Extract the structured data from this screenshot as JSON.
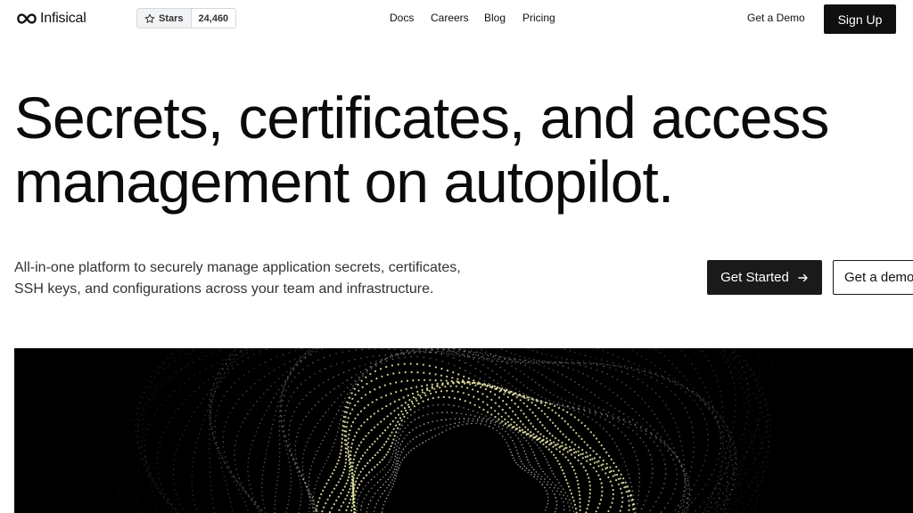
{
  "brand": {
    "name": "Infisical",
    "logo_icon": "infinity-icon"
  },
  "github": {
    "label": "Stars",
    "count": "24,460",
    "icon": "star-icon"
  },
  "nav": {
    "items": [
      {
        "label": "Docs"
      },
      {
        "label": "Careers"
      },
      {
        "label": "Blog"
      },
      {
        "label": "Pricing"
      }
    ],
    "demo": "Get a Demo",
    "signup": "Sign Up"
  },
  "hero": {
    "title_line1": "Secrets, certificates, and access",
    "title_line2": "management on autopilot.",
    "subtitle_line1": "All-in-one platform to securely manage application secrets, certificates,",
    "subtitle_line2": "SSH keys, and configurations across your team and infrastructure.",
    "cta_primary": "Get Started",
    "cta_secondary": "Get a demo"
  },
  "colors": {
    "text": "#111111",
    "button_dark": "#1a1a1a",
    "visual_bg": "#000000",
    "dot_accent": "#e6e6a8"
  }
}
